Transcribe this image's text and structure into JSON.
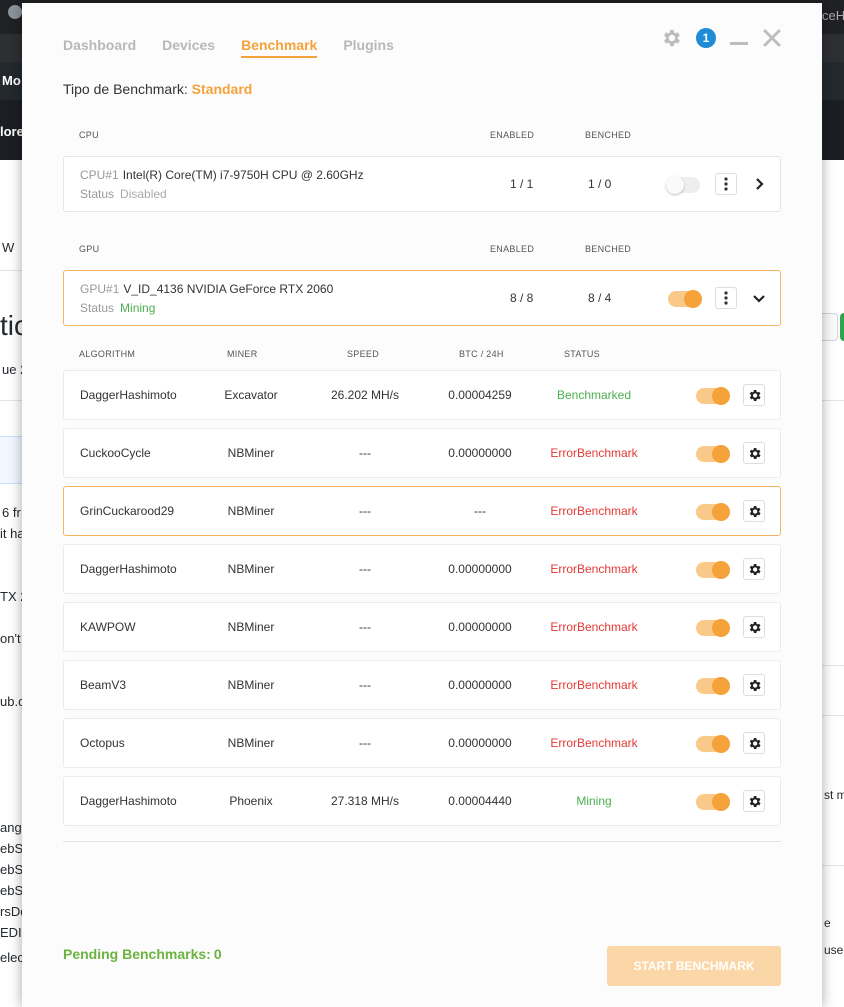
{
  "background": {
    "snippets": [
      "Mo",
      "lore",
      "W",
      "tic",
      "ue 2",
      "6 fr",
      "it ha",
      "TX 2",
      "on't",
      "ub.c",
      "ange",
      "ebS",
      "ebS",
      "ebS",
      "rsDo",
      "EDIS",
      "elec",
      "ceH",
      "st ma",
      "e",
      "use y"
    ]
  },
  "tabs": [
    {
      "label": "Dashboard"
    },
    {
      "label": "Devices"
    },
    {
      "label": "Benchmark"
    },
    {
      "label": "Plugins"
    }
  ],
  "header": {
    "notification_count": "1",
    "icons": {
      "settings": "gear-icon",
      "minimize": "minimize-icon",
      "close": "close-icon"
    }
  },
  "benchmark_type": {
    "label": "Tipo de Benchmark:",
    "value": "Standard"
  },
  "cpu_section": {
    "title": "CPU",
    "enabled_label": "ENABLED",
    "benched_label": "BENCHED",
    "device": {
      "id": "CPU#1",
      "name": "Intel(R) Core(TM) i7-9750H CPU @ 2.60GHz",
      "status_label": "Status",
      "status": "Disabled",
      "enabled": "1 / 1",
      "benched": "1 / 0",
      "toggle_on": false
    }
  },
  "gpu_section": {
    "title": "GPU",
    "enabled_label": "ENABLED",
    "benched_label": "BENCHED",
    "device": {
      "id": "GPU#1",
      "name": "V_ID_4136 NVIDIA GeForce RTX 2060",
      "status_label": "Status",
      "status": "Mining",
      "enabled": "8 / 8",
      "benched": "8 / 4",
      "toggle_on": true
    }
  },
  "algorithm_table": {
    "columns": {
      "algorithm": "ALGORITHM",
      "miner": "MINER",
      "speed": "SPEED",
      "btc": "BTC / 24H",
      "status": "STATUS"
    },
    "rows": [
      {
        "algorithm": "DaggerHashimoto",
        "miner": "Excavator",
        "speed": "26.202 MH/s",
        "btc": "0.00004259",
        "status": "Benchmarked",
        "status_type": "bench"
      },
      {
        "algorithm": "CuckooCycle",
        "miner": "NBMiner",
        "speed": "---",
        "btc": "0.00000000",
        "status": "ErrorBenchmark",
        "status_type": "error"
      },
      {
        "algorithm": "GrinCuckarood29",
        "miner": "NBMiner",
        "speed": "---",
        "btc": "---",
        "status": "ErrorBenchmark",
        "status_type": "error"
      },
      {
        "algorithm": "DaggerHashimoto",
        "miner": "NBMiner",
        "speed": "---",
        "btc": "0.00000000",
        "status": "ErrorBenchmark",
        "status_type": "error"
      },
      {
        "algorithm": "KAWPOW",
        "miner": "NBMiner",
        "speed": "---",
        "btc": "0.00000000",
        "status": "ErrorBenchmark",
        "status_type": "error"
      },
      {
        "algorithm": "BeamV3",
        "miner": "NBMiner",
        "speed": "---",
        "btc": "0.00000000",
        "status": "ErrorBenchmark",
        "status_type": "error"
      },
      {
        "algorithm": "Octopus",
        "miner": "NBMiner",
        "speed": "---",
        "btc": "0.00000000",
        "status": "ErrorBenchmark",
        "status_type": "error"
      },
      {
        "algorithm": "DaggerHashimoto",
        "miner": "Phoenix",
        "speed": "27.318 MH/s",
        "btc": "0.00004440",
        "status": "Mining",
        "status_type": "mining"
      }
    ]
  },
  "footer": {
    "pending_label": "Pending Benchmarks:",
    "pending_count": "0",
    "start_button": "START BENCHMARK"
  },
  "colors": {
    "accent": "#f6a23a",
    "mining": "#4caf50",
    "error": "#e53935",
    "badge": "#1e8cd6"
  }
}
